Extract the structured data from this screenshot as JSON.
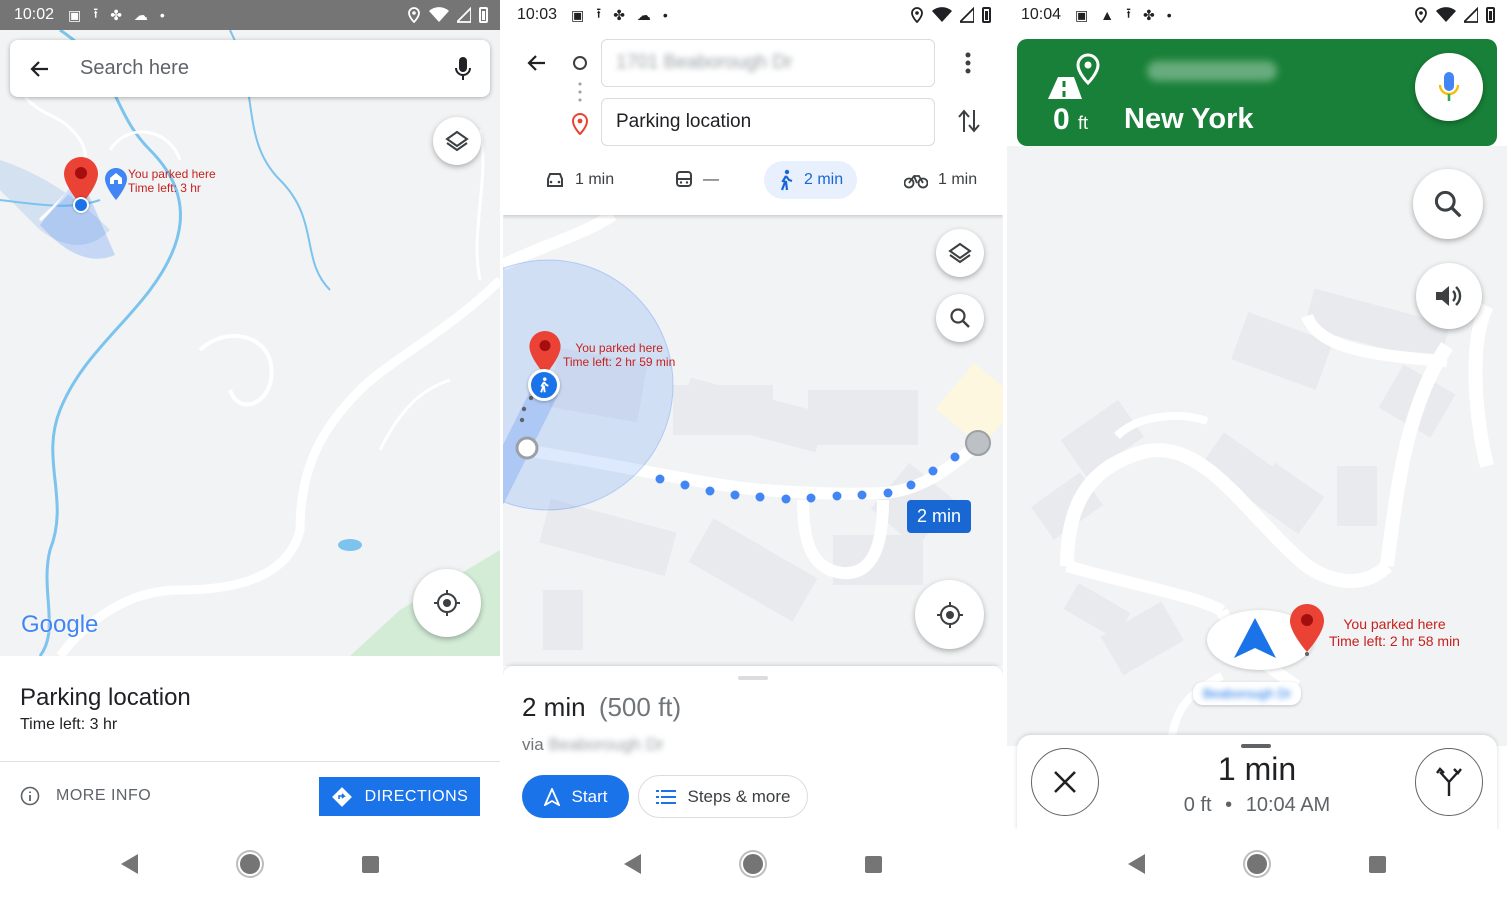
{
  "screen1": {
    "status": {
      "time": "10:02"
    },
    "search": {
      "placeholder": "Search here"
    },
    "map": {
      "marker_line1": "You parked here",
      "marker_line2": "Time left: 3 hr",
      "logo": "Google"
    },
    "sheet": {
      "title": "Parking location",
      "subtitle": "Time left: 3 hr",
      "more_info": "MORE INFO",
      "directions": "DIRECTIONS"
    }
  },
  "screen2": {
    "status": {
      "time": "10:03"
    },
    "origin": "1701 Beaborough Dr",
    "destination": "Parking location",
    "modes": [
      {
        "icon": "car-icon",
        "label": "1 min"
      },
      {
        "icon": "transit-icon",
        "label": "—"
      },
      {
        "icon": "walk-icon",
        "label": "2 min"
      },
      {
        "icon": "bike-icon",
        "label": "1 min"
      }
    ],
    "active_mode": "walk",
    "map": {
      "marker_line1": "You parked here",
      "marker_line2": "Time left: 2 hr 59 min",
      "route_badge": "2 min"
    },
    "sheet": {
      "duration": "2 min",
      "distance": "(500 ft)",
      "via_prefix": "via",
      "via_road": "Beaborough Dr",
      "start": "Start",
      "steps": "Steps & more"
    }
  },
  "screen3": {
    "status": {
      "time": "10:04"
    },
    "header": {
      "distance_value": "0",
      "distance_unit": "ft",
      "street": "New York",
      "blurred_top": "Beaborough"
    },
    "map": {
      "marker_line1": "You parked here",
      "marker_line2": "Time left: 2 hr 58 min",
      "road_label": "Beaborough Dr"
    },
    "sheet": {
      "eta": "1 min",
      "distance": "0 ft",
      "separator": "•",
      "arrival": "10:04 AM"
    }
  },
  "colors": {
    "accent_blue": "#1a73e8",
    "nav_green": "#188038",
    "marker_red": "#ea4335",
    "marker_text_red": "#c5221f",
    "route_dot_blue": "#4285f4",
    "map_bg": "#f1f3f4",
    "status_gray": "#757575"
  }
}
